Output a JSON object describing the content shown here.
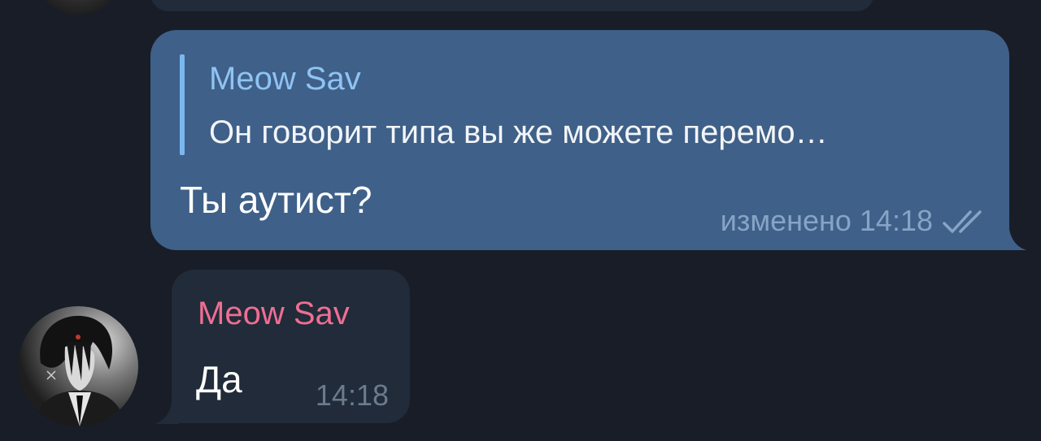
{
  "messages": {
    "outgoing": {
      "reply_to": {
        "name": "Meow Sav",
        "text": "Он говорит типа вы же можете перемо…"
      },
      "text": "Ты аутист?",
      "status": "изменено 14:18",
      "check_icon": "double-check-icon",
      "colors": {
        "bubble": "#3f6088",
        "reply_name": "#8fc3f4",
        "reply_bar": "#7bb8f1"
      }
    },
    "incoming": {
      "sender": "Meow Sav",
      "text": "Да",
      "time": "14:18",
      "colors": {
        "bubble": "#212b39",
        "sender_name": "#ef6e92"
      }
    }
  },
  "theme": {
    "background": "#181d27"
  }
}
